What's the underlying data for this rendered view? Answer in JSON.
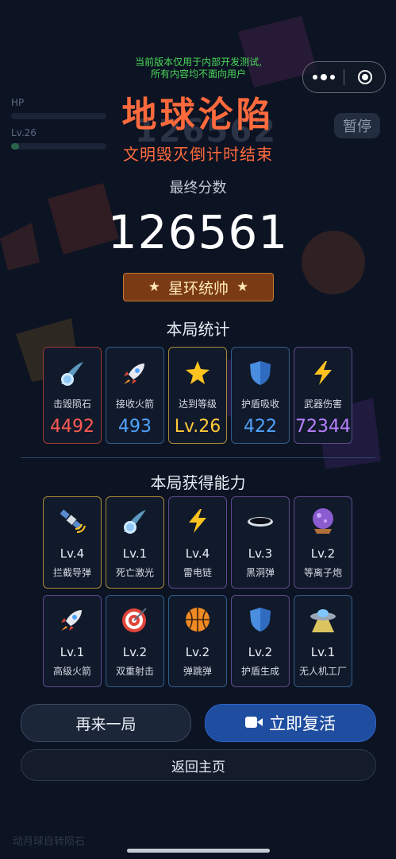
{
  "notice": {
    "line1": "当前版本仅用于内部开发测试,",
    "line2": "所有内容均不面向用户"
  },
  "background": {
    "hp_label": "HP",
    "level_label": "Lv.26",
    "score_ghost": "126562",
    "pause_label": "暂停",
    "footer_text": "动月球自转陨石"
  },
  "gameover": {
    "title": "地球沦陷",
    "subtitle": "文明毁灭倒计时结束",
    "score_label": "最终分数",
    "score": "126561",
    "rank_title": "星环统帅",
    "rank_star": "★"
  },
  "stats": {
    "section_title": "本局统计",
    "items": [
      {
        "icon": "meteor-icon",
        "label": "击毁陨石",
        "value": "4492",
        "color": "#ff5a52"
      },
      {
        "icon": "rocket-icon",
        "label": "接收火箭",
        "value": "493",
        "color": "#4fa3ff"
      },
      {
        "icon": "star-icon",
        "label": "达到等级",
        "value": "Lv.26",
        "color": "#ffc83a"
      },
      {
        "icon": "shield-icon",
        "label": "护盾吸收",
        "value": "422",
        "color": "#4fa3ff"
      },
      {
        "icon": "lightning-icon",
        "label": "武器伤害",
        "value": "72344",
        "color": "#b980ff"
      }
    ]
  },
  "abilities": {
    "section_title": "本局获得能力",
    "items": [
      {
        "icon": "satellite-icon",
        "level": "Lv.4",
        "name": "拦截导弹",
        "tier": "gold"
      },
      {
        "icon": "comet-icon",
        "level": "Lv.1",
        "name": "死亡激光",
        "tier": "gold"
      },
      {
        "icon": "lightning-icon",
        "level": "Lv.4",
        "name": "雷电链",
        "tier": "purple"
      },
      {
        "icon": "black-hole-icon",
        "level": "Lv.3",
        "name": "黑洞弹",
        "tier": "purple"
      },
      {
        "icon": "crystal-ball-icon",
        "level": "Lv.2",
        "name": "等离子炮",
        "tier": "purple"
      },
      {
        "icon": "rocket-icon",
        "level": "Lv.1",
        "name": "高级火箭",
        "tier": "purple"
      },
      {
        "icon": "target-icon",
        "level": "Lv.2",
        "name": "双重射击",
        "tier": "blue"
      },
      {
        "icon": "basketball-icon",
        "level": "Lv.2",
        "name": "弹跳弹",
        "tier": "blue"
      },
      {
        "icon": "shield-icon",
        "level": "Lv.2",
        "name": "护盾生成",
        "tier": "purple"
      },
      {
        "icon": "ufo-icon",
        "level": "Lv.1",
        "name": "无人机工厂",
        "tier": "blue"
      }
    ]
  },
  "buttons": {
    "play_again": "再来一局",
    "revive": "立即复活",
    "home": "返回主页"
  },
  "colors": {
    "title": "#ff6a3d",
    "notice": "#4ad85a",
    "revive_button": "#1f4ea0",
    "rank_badge": "#7a3a14"
  }
}
